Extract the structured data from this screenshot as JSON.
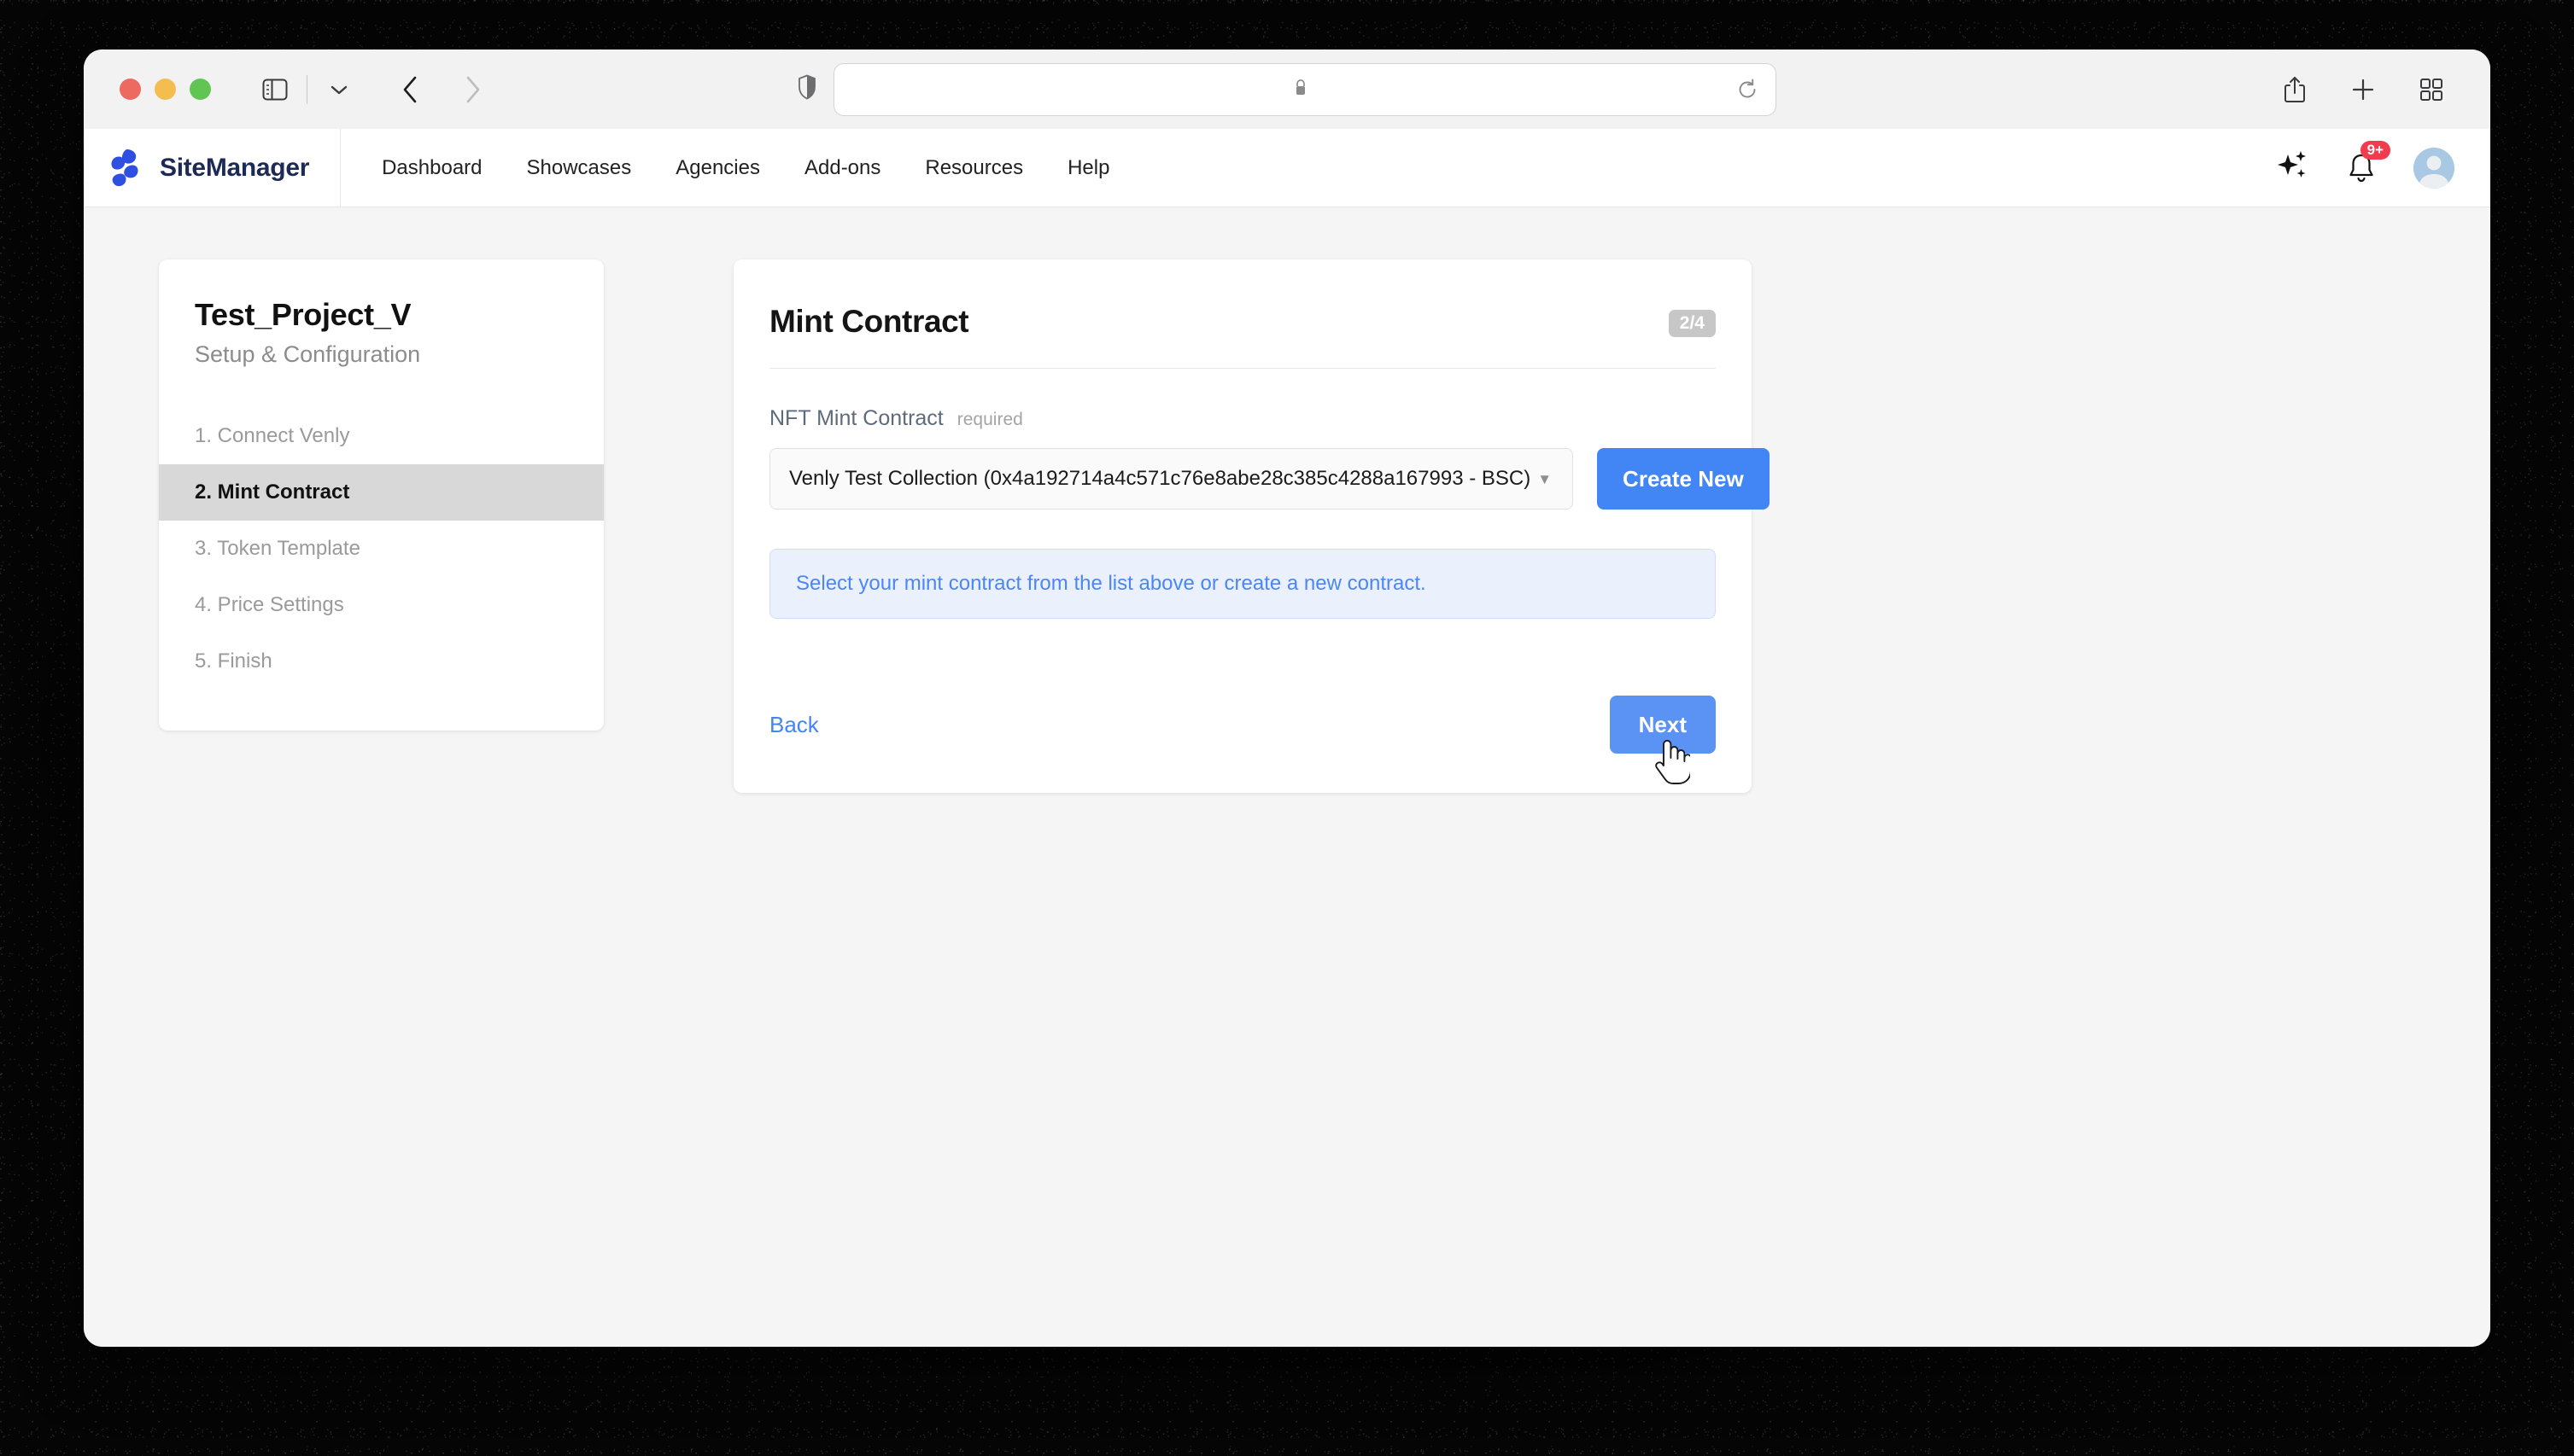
{
  "browser": {
    "traffic_lights": [
      "close",
      "minimize",
      "zoom"
    ],
    "sidebar_toggle_icon": "sidebar-icon",
    "tab_dropdown_icon": "chevron-down-icon",
    "back_icon": "chevron-left-icon",
    "forward_icon": "chevron-right-icon",
    "shield_icon": "shield-icon",
    "address": {
      "lock_icon": "lock-icon",
      "url": "",
      "placeholder": "",
      "reload_icon": "reload-icon"
    },
    "share_icon": "share-icon",
    "new_tab_icon": "plus-icon",
    "tab_overview_icon": "tab-overview-icon"
  },
  "header": {
    "brand": "SiteManager",
    "logo_icon": "sitemanager-logo-icon",
    "nav": [
      {
        "label": "Dashboard"
      },
      {
        "label": "Showcases"
      },
      {
        "label": "Agencies"
      },
      {
        "label": "Add-ons"
      },
      {
        "label": "Resources"
      },
      {
        "label": "Help"
      }
    ],
    "sparkle_icon": "sparkles-icon",
    "bell_icon": "bell-icon",
    "notification_count": "9+",
    "avatar_icon": "user-avatar-icon",
    "accent_color": "#2f4fe0",
    "badge_color": "#f23b4d"
  },
  "sidebar": {
    "project_title": "Test_Project_V",
    "subtitle": "Setup & Configuration",
    "steps": [
      {
        "label": "1. Connect Venly",
        "active": false
      },
      {
        "label": "2. Mint Contract",
        "active": true
      },
      {
        "label": "3. Token Template",
        "active": false
      },
      {
        "label": "4. Price Settings",
        "active": false
      },
      {
        "label": "5. Finish",
        "active": false
      }
    ]
  },
  "main": {
    "title": "Mint Contract",
    "step_badge": "2/4",
    "field": {
      "label": "NFT Mint Contract",
      "required_text": "required",
      "selected_value": "Venly Test Collection (0x4a192714a4c571c76e8abe28c385c4288a167993 - BSC)",
      "caret_icon": "caret-down-icon",
      "create_button": "Create New"
    },
    "info_message": "Select your mint contract from the list above or create a new contract.",
    "back_label": "Back",
    "next_label": "Next",
    "accent_blue": "#4285f4",
    "info_bg": "#eaf1fd",
    "badge_gray": "#c7c7c7"
  },
  "cursor": {
    "type": "pointer-hand"
  }
}
